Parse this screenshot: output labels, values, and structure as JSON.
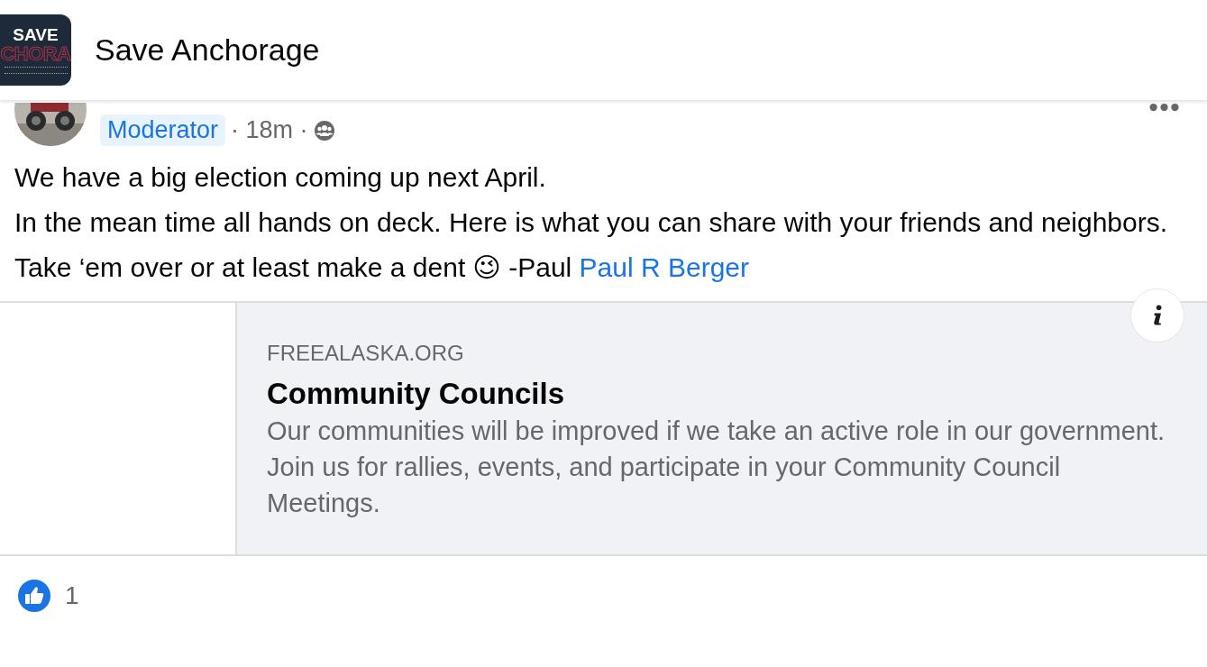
{
  "header": {
    "logo": {
      "line_1": "SAVE",
      "line_2": "CHORA"
    },
    "title": "Save Anchorage"
  },
  "post": {
    "badge": "Moderator",
    "time": "· 18m ·",
    "paragraphs": [
      {
        "text": "We have a big election coming up next April."
      },
      {
        "text": "In the mean time all hands on deck. Here is what you can share with your friends and neighbors."
      },
      {
        "text": "Take ‘em over or at least make a dent",
        "emoji": "😉",
        "signature": "-Paul",
        "mention": "Paul R Berger"
      }
    ],
    "link_card": {
      "domain": "FREEALASKA.ORG",
      "title": "Community Councils",
      "description": "Our communities will be improved if we take an active role in our government. Join us for rallies, events, and participate in your Community Council Meetings."
    },
    "reactions": {
      "count": "1"
    }
  }
}
